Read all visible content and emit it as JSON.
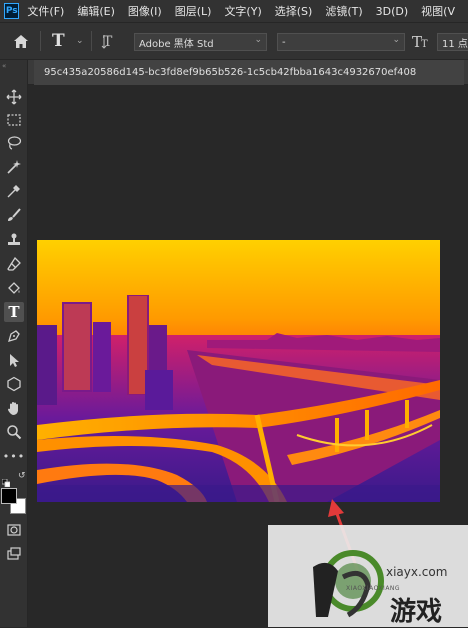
{
  "app": {
    "logo": "Ps"
  },
  "menu": [
    "文件(F)",
    "编辑(E)",
    "图像(I)",
    "图层(L)",
    "文字(Y)",
    "选择(S)",
    "滤镜(T)",
    "3D(D)",
    "视图(V"
  ],
  "options_bar": {
    "tool_icon": "type-tool-icon",
    "font_family": "Adobe 黑体 Std",
    "font_style": "-",
    "font_size": "11 点"
  },
  "document": {
    "tab_title": "95c435a20586d145-bc3fd8ef9b65b526-1c5cb42fbba1643c4932670ef408"
  },
  "toolbar": [
    "move-tool-icon",
    "marquee-tool-icon",
    "lasso-tool-icon",
    "magic-wand-icon",
    "eyedropper-icon",
    "brush-icon",
    "stamp-icon",
    "eraser-icon",
    "paint-bucket-icon",
    "type-tool-icon",
    "pen-icon",
    "path-select-icon",
    "shape-icon",
    "hand-icon",
    "zoom-icon",
    "more-tools-icon"
  ],
  "watermark": {
    "site": "xiayx.com",
    "sub": "XIAOXIAOXIANG",
    "brand": "游戏"
  }
}
